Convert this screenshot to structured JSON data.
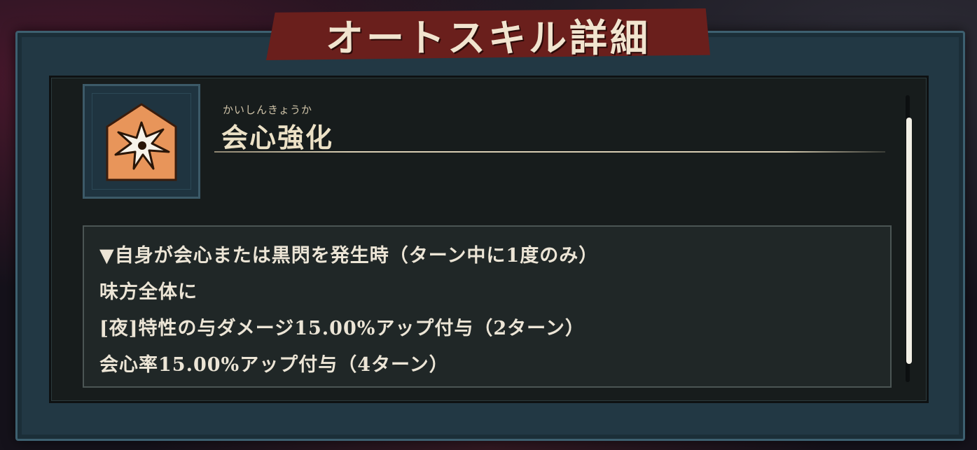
{
  "dialog": {
    "title": "オートスキル詳細"
  },
  "skill": {
    "icon": "crit-burst-icon",
    "name_ruby": "かいしんきょうか",
    "name": "会心強化"
  },
  "description": {
    "lines": [
      "▼自身が会心または黒閃を発生時（ターン中に1度のみ）",
      "味方全体に",
      "[夜]特性の与ダメージ15.00%アップ付与（2ターン）",
      "会心率15.00%アップ付与（4ターン）"
    ]
  },
  "colors": {
    "banner": "#6a1f1c",
    "frame": "#223844",
    "panel": "#171c1c",
    "icon_badge": "#e8955a",
    "text": "#ece5d6"
  }
}
